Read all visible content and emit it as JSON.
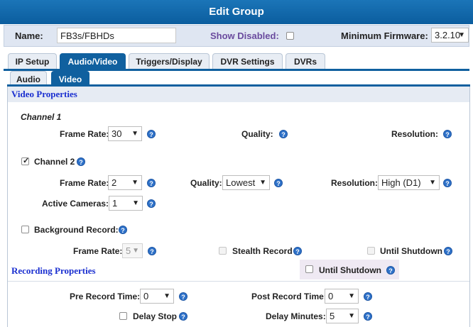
{
  "title": "Edit Group",
  "header": {
    "name_label": "Name:",
    "name_value": "FB3s/FBHDs",
    "show_disabled_label": "Show Disabled:",
    "min_firmware_label": "Minimum Firmware:",
    "min_firmware_value": "3.2.10"
  },
  "tabs": [
    "IP Setup",
    "Audio/Video",
    "Triggers/Display",
    "DVR Settings",
    "DVRs"
  ],
  "subtabs": [
    "Audio",
    "Video"
  ],
  "video": {
    "section_title": "Video Properties",
    "channel1": {
      "title": "Channel 1",
      "frame_rate_label": "Frame Rate:",
      "frame_rate_value": "30",
      "quality_label": "Quality:",
      "resolution_label": "Resolution:"
    },
    "channel2": {
      "title": "Channel 2",
      "checked": true,
      "frame_rate_label": "Frame Rate:",
      "frame_rate_value": "2",
      "quality_label": "Quality:",
      "quality_value": "Lowest",
      "resolution_label": "Resolution:",
      "resolution_value": "High (D1)",
      "active_cameras_label": "Active Cameras:",
      "active_cameras_value": "1"
    },
    "background": {
      "title": "Background Record:",
      "frame_rate_label": "Frame Rate:",
      "frame_rate_value": "5",
      "stealth_label": "Stealth Record",
      "until_shutdown_label": "Until Shutdown"
    }
  },
  "recording": {
    "section_title": "Recording Properties",
    "until_shutdown_label": "Until Shutdown",
    "pre_record_label": "Pre Record Time:",
    "pre_record_value": "0",
    "post_record_label": "Post Record Time:",
    "post_record_value": "0",
    "delay_stop_label": "Delay Stop",
    "delay_minutes_label": "Delay Minutes:",
    "delay_minutes_value": "5"
  },
  "icons": {
    "help": "help-icon",
    "dropdown": "dropdown-arrow-icon",
    "checkbox": "checkbox-icon"
  },
  "colors": {
    "title_bar": "#0b5d9e",
    "active_tab": "#10609f",
    "section_text": "#1a2fd0",
    "help_icon": "#2f72c9"
  }
}
